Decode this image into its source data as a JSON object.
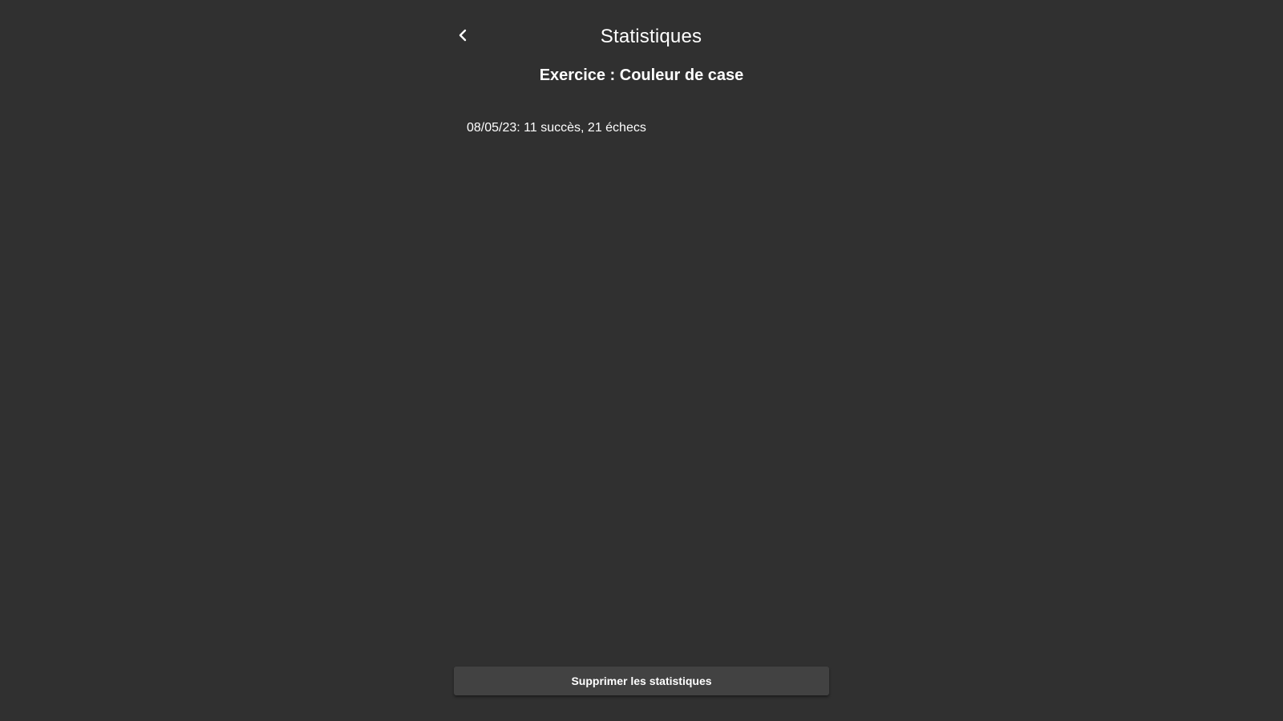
{
  "header": {
    "back_icon": "chevron-left-icon",
    "title": "Statistiques"
  },
  "exercise": {
    "title": "Exercice : Couleur de case"
  },
  "stats": [
    {
      "text": "08/05/23: 11 succès, 21 échecs"
    }
  ],
  "actions": {
    "delete_label": "Supprimer les statistiques"
  },
  "colors": {
    "background": "#303030",
    "button": "#424242",
    "text": "#ffffff"
  }
}
